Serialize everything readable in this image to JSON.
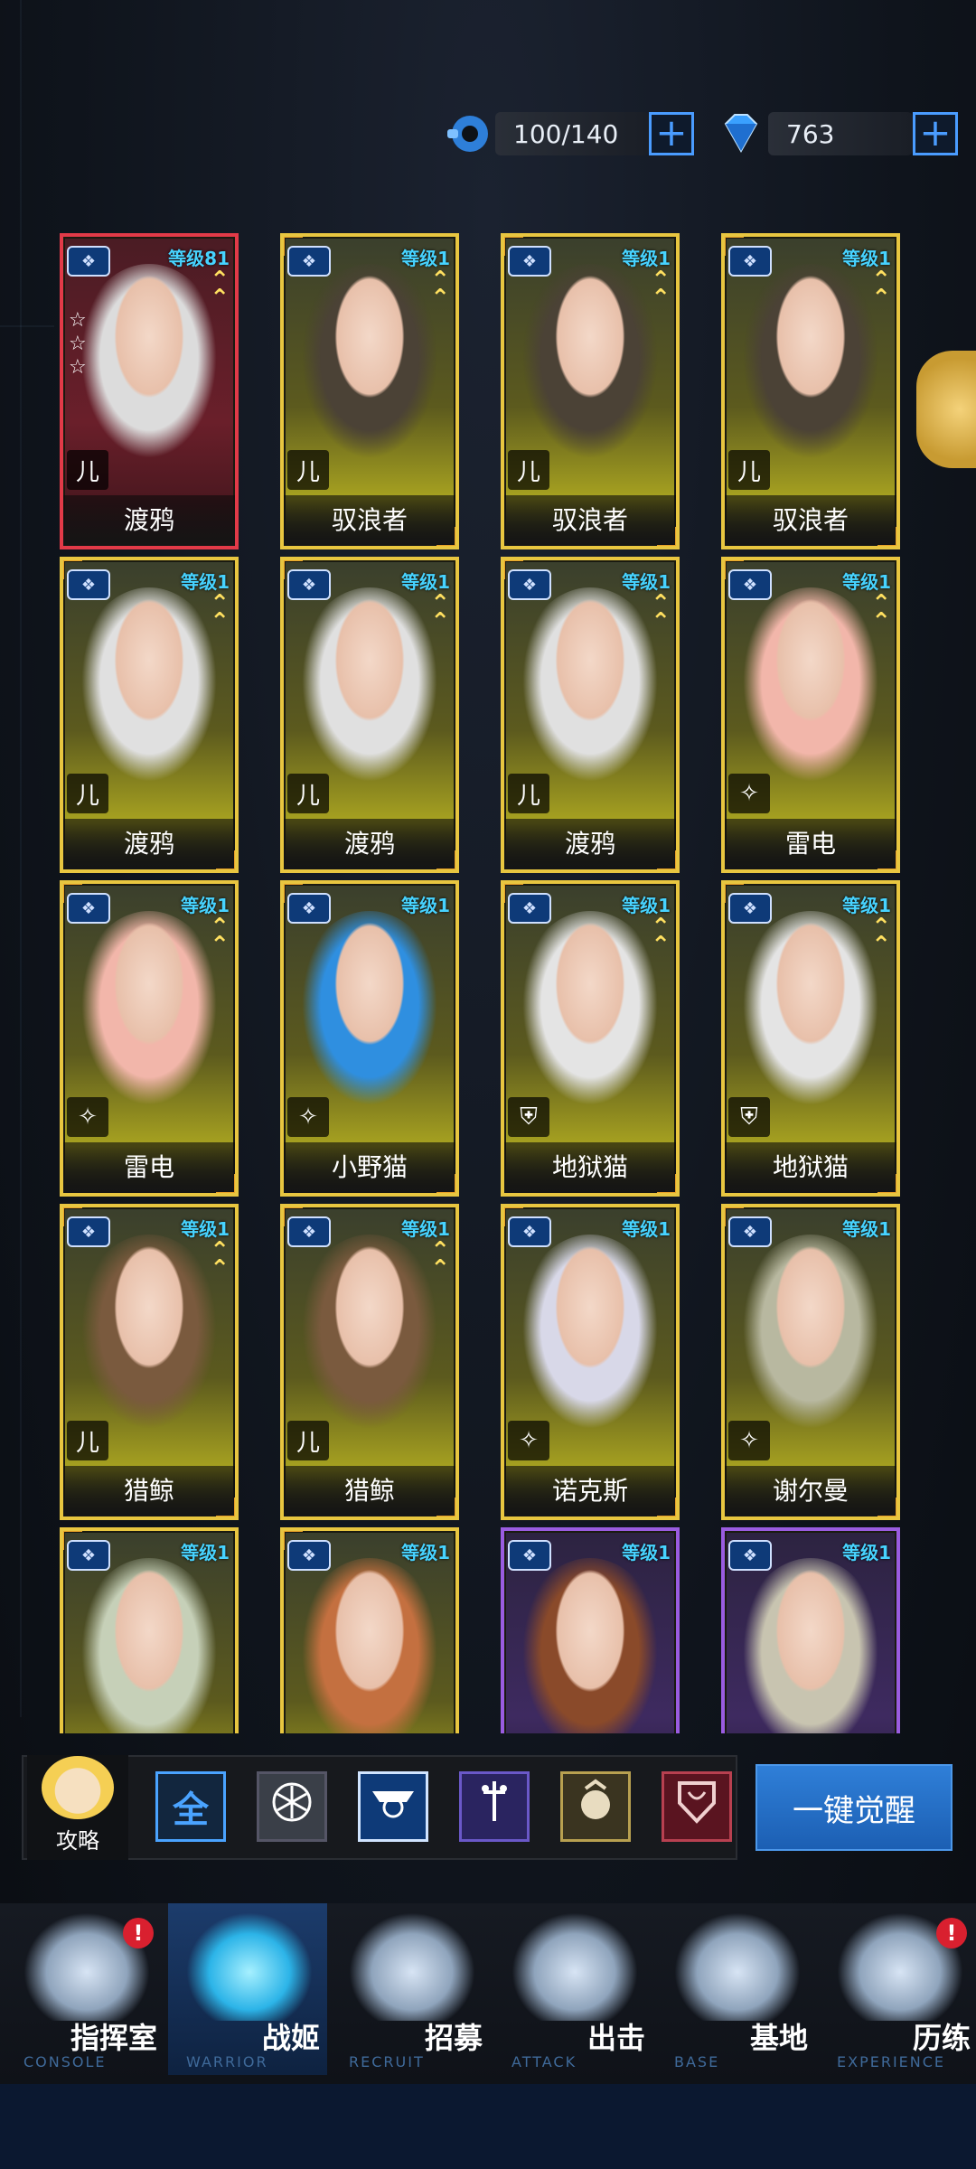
{
  "resources": {
    "stamina": {
      "icon": "stamina-icon",
      "value": "100/140"
    },
    "diamond": {
      "icon": "diamond-icon",
      "value": "763"
    }
  },
  "level_prefix": "等级",
  "cards": [
    {
      "name": "渡鸦",
      "level": "81",
      "rarity": "red",
      "stars": 3,
      "hair": "#dcdcdc",
      "class_icon": "winged-icon"
    },
    {
      "name": "驭浪者",
      "level": "1",
      "rarity": "gold",
      "hair": "#4b4236",
      "class_icon": "winged-icon"
    },
    {
      "name": "驭浪者",
      "level": "1",
      "rarity": "gold",
      "hair": "#4b4236",
      "class_icon": "winged-icon"
    },
    {
      "name": "驭浪者",
      "level": "1",
      "rarity": "gold",
      "hair": "#4b4236",
      "class_icon": "winged-icon"
    },
    {
      "name": "渡鸦",
      "level": "1",
      "rarity": "gold",
      "hair": "#e0e0e0",
      "class_icon": "winged-icon"
    },
    {
      "name": "渡鸦",
      "level": "1",
      "rarity": "gold",
      "hair": "#e0e0e0",
      "class_icon": "winged-icon"
    },
    {
      "name": "渡鸦",
      "level": "1",
      "rarity": "gold",
      "hair": "#e0e0e0",
      "class_icon": "winged-icon"
    },
    {
      "name": "雷电",
      "level": "1",
      "rarity": "gold",
      "hair": "#f2b6aa",
      "class_icon": "eagle-icon"
    },
    {
      "name": "雷电",
      "level": "1",
      "rarity": "gold",
      "hair": "#f2b6aa",
      "class_icon": "eagle-icon"
    },
    {
      "name": "小野猫",
      "level": "1",
      "rarity": "gold",
      "hair": "#2f8fe0",
      "class_icon": "eagle-icon"
    },
    {
      "name": "地狱猫",
      "level": "1",
      "rarity": "gold",
      "hair": "#e4e4e4",
      "class_icon": "shield-icon"
    },
    {
      "name": "地狱猫",
      "level": "1",
      "rarity": "gold",
      "hair": "#e4e4e4",
      "class_icon": "shield-icon"
    },
    {
      "name": "猎鲸",
      "level": "1",
      "rarity": "gold",
      "hair": "#7a5a3e",
      "class_icon": "winged-icon"
    },
    {
      "name": "猎鲸",
      "level": "1",
      "rarity": "gold",
      "hair": "#7a5a3e",
      "class_icon": "winged-icon"
    },
    {
      "name": "诺克斯",
      "level": "1",
      "rarity": "gold",
      "hair": "#d8d8e8",
      "class_icon": "eagle-icon"
    },
    {
      "name": "谢尔曼",
      "level": "1",
      "rarity": "gold",
      "hair": "#b8b8a0",
      "class_icon": "eagle-icon"
    },
    {
      "name": "",
      "level": "1",
      "rarity": "gold",
      "hair": "#c6d0b8",
      "class_icon": ""
    },
    {
      "name": "",
      "level": "1",
      "rarity": "gold",
      "hair": "#c47040",
      "class_icon": ""
    },
    {
      "name": "",
      "level": "1",
      "rarity": "purple",
      "hair": "#8a4a2a",
      "class_icon": ""
    },
    {
      "name": "",
      "level": "1",
      "rarity": "purple",
      "hair": "#c8c4b0",
      "class_icon": ""
    }
  ],
  "guide": {
    "label": "攻略"
  },
  "filters": [
    {
      "id": "all",
      "label": "全",
      "icon": ""
    },
    {
      "id": "snowflake",
      "label": "",
      "icon": "snowflake-icon"
    },
    {
      "id": "eagle-faction",
      "label": "",
      "icon": "eagle-faction-icon"
    },
    {
      "id": "sword",
      "label": "",
      "icon": "sword-icon"
    },
    {
      "id": "lion",
      "label": "",
      "icon": "lion-icon"
    },
    {
      "id": "dragon",
      "label": "",
      "icon": "dragon-shield-icon"
    }
  ],
  "awaken_button": "一键觉醒",
  "nav": [
    {
      "label": "指挥室",
      "en": "CONSOLE",
      "alert": "!"
    },
    {
      "label": "战姬",
      "en": "WARRIOR",
      "alert": ""
    },
    {
      "label": "招募",
      "en": "RECRUIT",
      "alert": ""
    },
    {
      "label": "出击",
      "en": "ATTACK",
      "alert": ""
    },
    {
      "label": "基地",
      "en": "BASE",
      "alert": ""
    },
    {
      "label": "历练",
      "en": "EXPERIENCE",
      "alert": "!"
    }
  ],
  "colors": {
    "gold_border": "#e8c640",
    "red_border": "#e23a48",
    "purple_border": "#9a5ce0",
    "level_text": "#47d3ff",
    "accent_blue": "#4a9cff"
  }
}
